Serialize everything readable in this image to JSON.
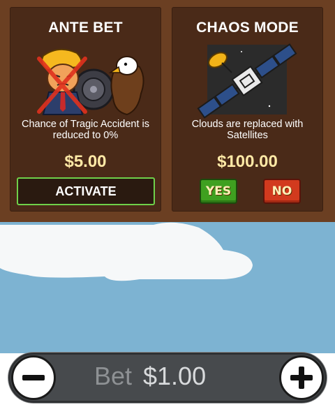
{
  "ante_bet": {
    "title": "ANTE BET",
    "description": "Chance of Tragic Accident is reduced to 0%",
    "price": "$5.00",
    "activate_label": "ACTIVATE",
    "art_icon": "crossed-out-president-and-eagle-with-cannon"
  },
  "chaos_mode": {
    "title": "CHAOS MODE",
    "description": "Clouds are replaced with Satellites",
    "price": "$100.00",
    "yes_label": "YES",
    "no_label": "NO",
    "art_icon": "satellite-icon"
  },
  "bet_bar": {
    "bet_label": "Bet",
    "bet_amount": "$1.00",
    "minus_icon": "minus-icon",
    "plus_icon": "plus-icon"
  },
  "colors": {
    "card_bg": "#4a2a18",
    "panel_bg": "#6b3f22",
    "price": "#ffe9a6",
    "activate_border": "#6fd14a",
    "yes": "#3fa020",
    "no": "#d23a1e",
    "sky": "#7db3d2"
  }
}
